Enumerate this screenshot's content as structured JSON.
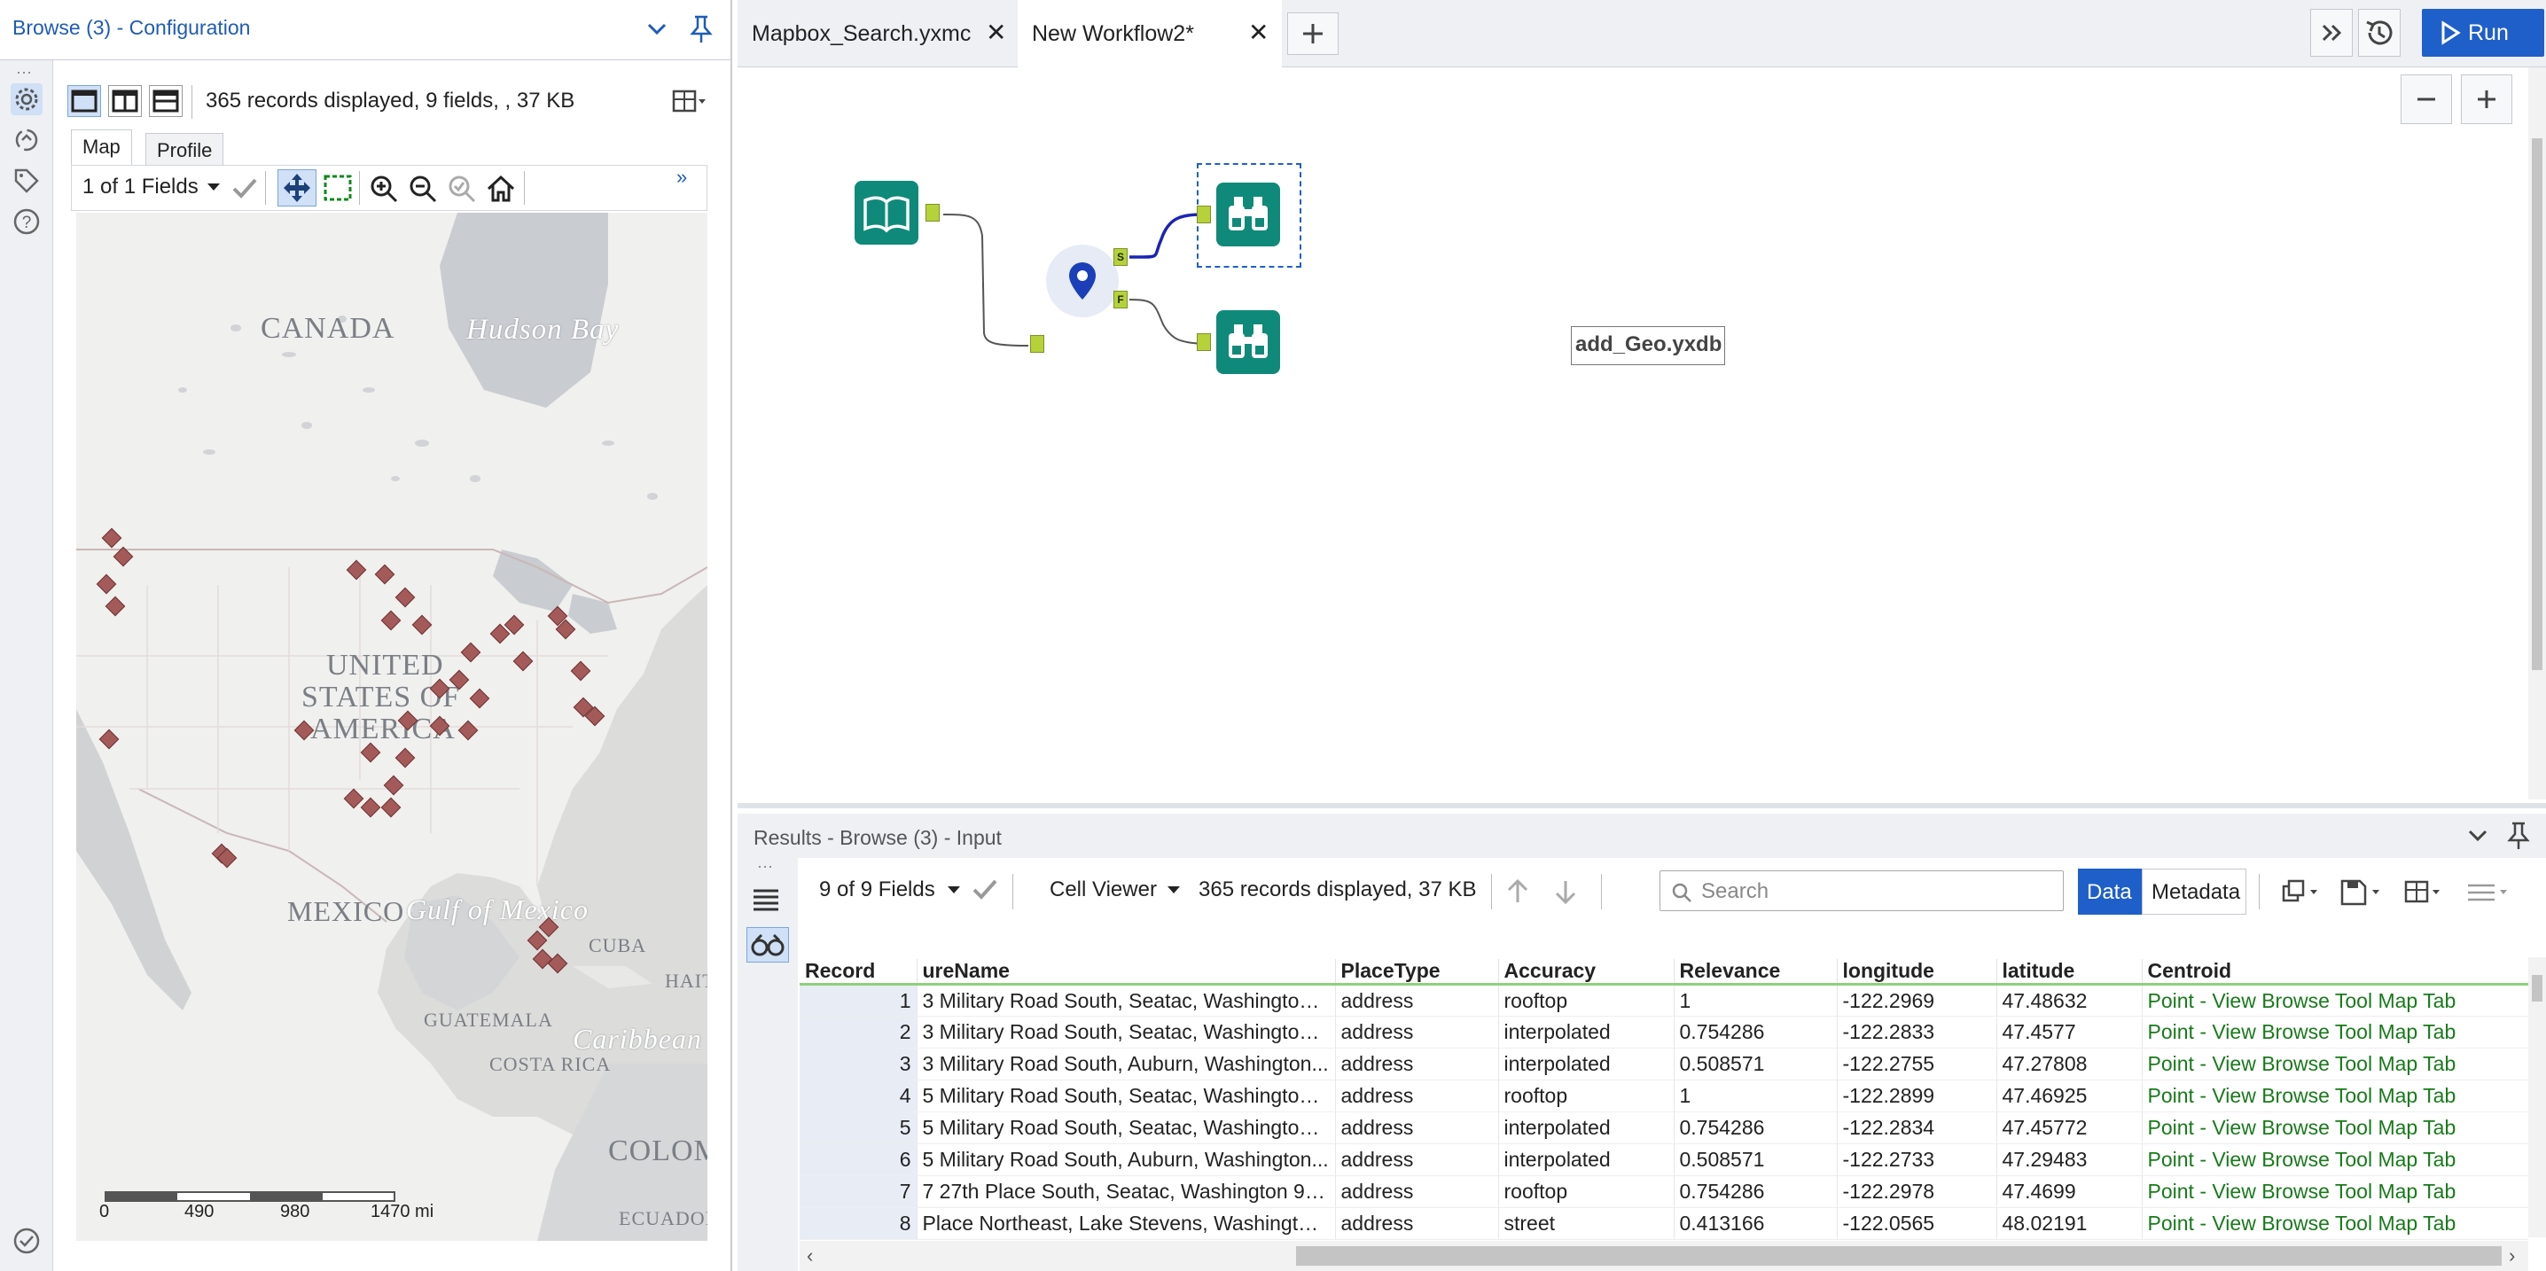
{
  "config": {
    "title": "Browse (3) - Configuration",
    "records_info": "365 records displayed, 9 fields, , 37 KB",
    "tabs": [
      "Map",
      "Profile"
    ],
    "fields_label": "1 of 1 Fields",
    "map_labels": {
      "canada": "CANADA",
      "hudson": "Hudson Bay",
      "usa1": "UNITED",
      "usa2": "STATES OF",
      "usa3": "AMERICA",
      "mexico": "MEXICO",
      "gulf": "Gulf of Mexico",
      "cuba": "CUBA",
      "haiti": "HAIT",
      "guatemala": "GUATEMALA",
      "caribbean": "Caribbean",
      "costarica": "COSTA RICA",
      "colombia": "COLOM",
      "ecuador": "ECUADOR"
    },
    "scale": {
      "t0": "0",
      "t1": "490",
      "t2": "980",
      "t3": "1470 mi"
    }
  },
  "workflow": {
    "tabs": [
      {
        "label": "Mapbox_Search.yxmc"
      },
      {
        "label": "New Workflow2*"
      }
    ],
    "run_label": "Run",
    "node_label": "add_Geo.yxdb",
    "anchor_s": "S",
    "anchor_f": "F"
  },
  "results": {
    "title": "Results - Browse (3) - Input",
    "fields_label": "9 of 9 Fields",
    "viewer_label": "Cell Viewer",
    "records_info": "365 records displayed, 37 KB",
    "search_placeholder": "Search",
    "data_btn": "Data",
    "metadata_btn": "Metadata",
    "columns": [
      "Record",
      "ureName",
      "PlaceType",
      "Accuracy",
      "Relevance",
      "longitude",
      "latitude",
      "Centroid"
    ],
    "rows": [
      [
        "1",
        "3 Military Road South, Seatac, Washington 9...",
        "address",
        "rooftop",
        "1",
        "-122.2969",
        "47.48632",
        "Point - View Browse Tool Map Tab"
      ],
      [
        "2",
        "3 Military Road South, Seatac, Washington 9...",
        "address",
        "interpolated",
        "0.754286",
        "-122.2833",
        "47.4577",
        "Point - View Browse Tool Map Tab"
      ],
      [
        "3",
        "3 Military Road South, Auburn, Washington...",
        "address",
        "interpolated",
        "0.508571",
        "-122.2755",
        "47.27808",
        "Point - View Browse Tool Map Tab"
      ],
      [
        "4",
        "5 Military Road South, Seatac, Washington 9...",
        "address",
        "rooftop",
        "1",
        "-122.2899",
        "47.46925",
        "Point - View Browse Tool Map Tab"
      ],
      [
        "5",
        "5 Military Road South, Seatac, Washington 9...",
        "address",
        "interpolated",
        "0.754286",
        "-122.2834",
        "47.45772",
        "Point - View Browse Tool Map Tab"
      ],
      [
        "6",
        "5 Military Road South, Auburn, Washington...",
        "address",
        "interpolated",
        "0.508571",
        "-122.2733",
        "47.29483",
        "Point - View Browse Tool Map Tab"
      ],
      [
        "7",
        "7 27th Place South, Seatac, Washington 981...",
        "address",
        "rooftop",
        "0.754286",
        "-122.2978",
        "47.4699",
        "Point - View Browse Tool Map Tab"
      ],
      [
        "8",
        "Place Northeast, Lake Stevens, Washington...",
        "address",
        "street",
        "0.413166",
        "-122.0565",
        "48.02191",
        "Point - View Browse Tool Map Tab"
      ]
    ]
  }
}
